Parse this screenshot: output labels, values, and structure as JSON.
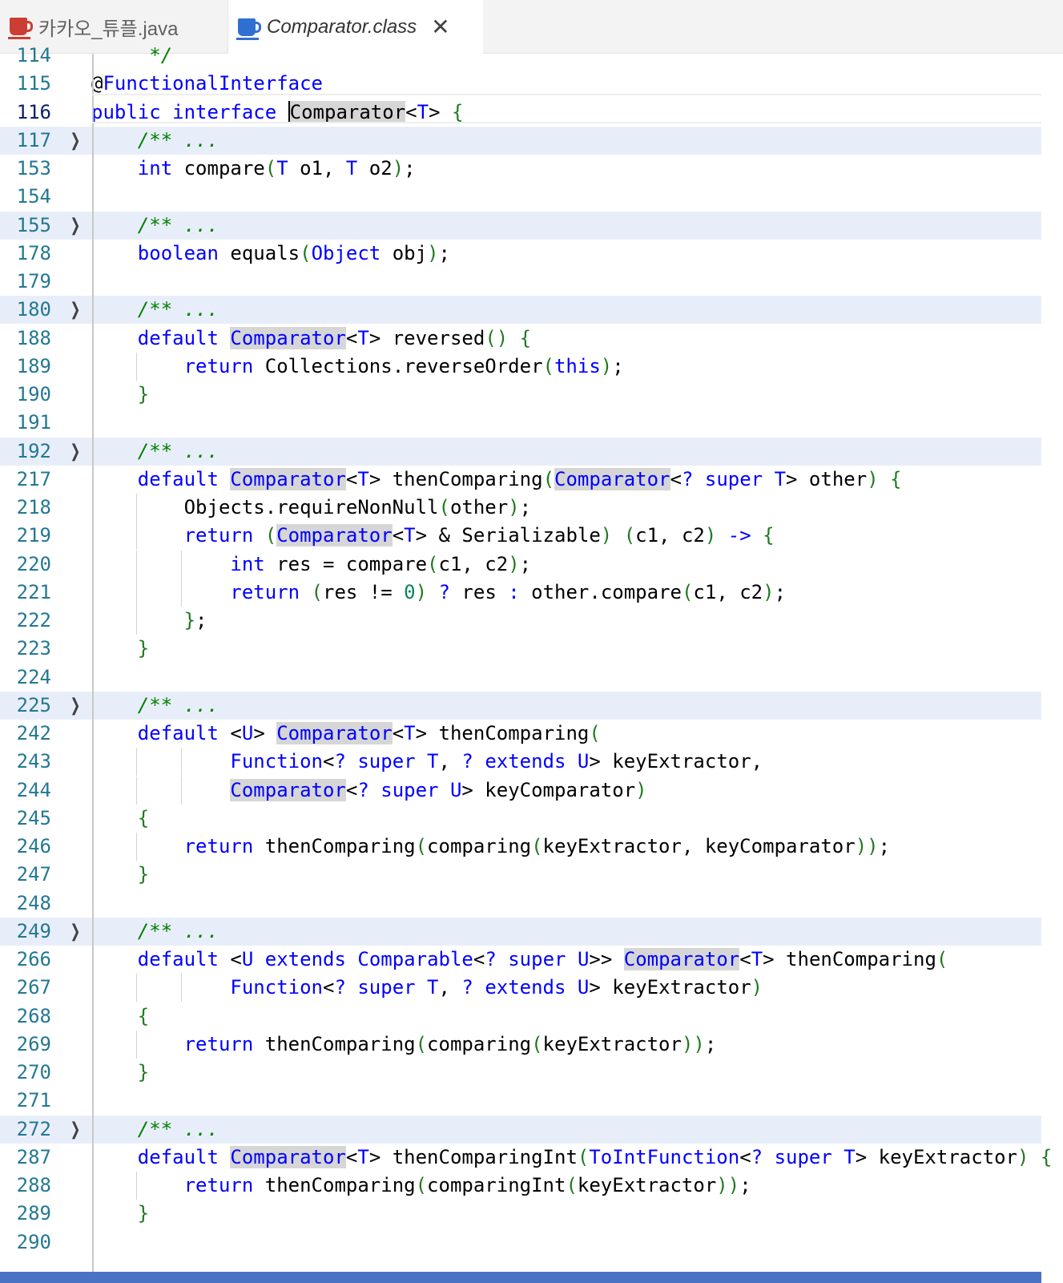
{
  "tabs": [
    {
      "label": "카카오_튜플.java",
      "active": false
    },
    {
      "label": "Comparator.class",
      "active": true,
      "close": "✕"
    }
  ],
  "editor": {
    "lines": [
      {
        "n": "114",
        "segs": [
          [
            "",
            "    "
          ],
          [
            "c",
            " */"
          ]
        ],
        "top_partial": true
      },
      {
        "n": "115",
        "segs": [
          [
            "",
            "@"
          ],
          [
            "k",
            "FunctionalInterface"
          ]
        ]
      },
      {
        "n": "116",
        "segs": [
          [
            "k",
            "public"
          ],
          [
            "",
            " "
          ],
          [
            "k",
            "interface"
          ],
          [
            "",
            " "
          ],
          [
            "cur",
            ""
          ],
          [
            "hi",
            "Comparator"
          ],
          [
            "",
            "<"
          ],
          [
            "k",
            "T"
          ],
          [
            "",
            "> "
          ],
          [
            "b",
            "{"
          ]
        ],
        "current": true
      },
      {
        "n": "117",
        "fold": true,
        "segs": [
          [
            "",
            "    "
          ],
          [
            "c",
            "/** ..."
          ]
        ]
      },
      {
        "n": "153",
        "segs": [
          [
            "",
            "    "
          ],
          [
            "k",
            "int"
          ],
          [
            "",
            " compare"
          ],
          [
            "b",
            "("
          ],
          [
            "k",
            "T"
          ],
          [
            "",
            " o1, "
          ],
          [
            "k",
            "T"
          ],
          [
            "",
            " o2"
          ],
          [
            "b",
            ")"
          ],
          [
            "",
            ";"
          ]
        ]
      },
      {
        "n": "154",
        "segs": []
      },
      {
        "n": "155",
        "fold": true,
        "segs": [
          [
            "",
            "    "
          ],
          [
            "c",
            "/** ..."
          ]
        ]
      },
      {
        "n": "178",
        "segs": [
          [
            "",
            "    "
          ],
          [
            "k",
            "boolean"
          ],
          [
            "",
            " equals"
          ],
          [
            "b",
            "("
          ],
          [
            "k",
            "Object"
          ],
          [
            "",
            " obj"
          ],
          [
            "b",
            ")"
          ],
          [
            "",
            ";"
          ]
        ]
      },
      {
        "n": "179",
        "segs": []
      },
      {
        "n": "180",
        "fold": true,
        "segs": [
          [
            "",
            "    "
          ],
          [
            "c",
            "/** ..."
          ]
        ]
      },
      {
        "n": "188",
        "segs": [
          [
            "",
            "    "
          ],
          [
            "k",
            "default"
          ],
          [
            "",
            " "
          ],
          [
            "hik",
            "Comparator"
          ],
          [
            "",
            "<"
          ],
          [
            "k",
            "T"
          ],
          [
            "",
            "> reversed"
          ],
          [
            "b",
            "()"
          ],
          [
            "",
            " "
          ],
          [
            "b",
            "{"
          ]
        ]
      },
      {
        "n": "189",
        "guides": [
          1
        ],
        "segs": [
          [
            "",
            "        "
          ],
          [
            "k",
            "return"
          ],
          [
            "",
            " Collections.reverseOrder"
          ],
          [
            "b",
            "("
          ],
          [
            "k",
            "this"
          ],
          [
            "b",
            ")"
          ],
          [
            "",
            ";"
          ]
        ]
      },
      {
        "n": "190",
        "segs": [
          [
            "",
            "    "
          ],
          [
            "b",
            "}"
          ]
        ]
      },
      {
        "n": "191",
        "segs": []
      },
      {
        "n": "192",
        "fold": true,
        "segs": [
          [
            "",
            "    "
          ],
          [
            "c",
            "/** ..."
          ]
        ]
      },
      {
        "n": "217",
        "segs": [
          [
            "",
            "    "
          ],
          [
            "k",
            "default"
          ],
          [
            "",
            " "
          ],
          [
            "hik",
            "Comparator"
          ],
          [
            "",
            "<"
          ],
          [
            "k",
            "T"
          ],
          [
            "",
            "> thenComparing"
          ],
          [
            "b",
            "("
          ],
          [
            "hik",
            "Comparator"
          ],
          [
            "",
            "<"
          ],
          [
            "k",
            "?"
          ],
          [
            "",
            " "
          ],
          [
            "k",
            "super"
          ],
          [
            "",
            " "
          ],
          [
            "k",
            "T"
          ],
          [
            "",
            "> other"
          ],
          [
            "b",
            ")"
          ],
          [
            "",
            " "
          ],
          [
            "b",
            "{"
          ]
        ]
      },
      {
        "n": "218",
        "guides": [
          1
        ],
        "segs": [
          [
            "",
            "        Objects.requireNonNull"
          ],
          [
            "b",
            "("
          ],
          [
            "",
            "other"
          ],
          [
            "b",
            ")"
          ],
          [
            "",
            ";"
          ]
        ]
      },
      {
        "n": "219",
        "guides": [
          1
        ],
        "segs": [
          [
            "",
            "        "
          ],
          [
            "k",
            "return"
          ],
          [
            "",
            " "
          ],
          [
            "b",
            "("
          ],
          [
            "hik",
            "Comparator"
          ],
          [
            "",
            "<"
          ],
          [
            "k",
            "T"
          ],
          [
            "",
            "> & Serializable"
          ],
          [
            "b",
            ")"
          ],
          [
            "",
            " "
          ],
          [
            "b",
            "("
          ],
          [
            "",
            "c1, c2"
          ],
          [
            "b",
            ")"
          ],
          [
            "",
            " "
          ],
          [
            "k",
            "->"
          ],
          [
            "",
            " "
          ],
          [
            "b",
            "{"
          ]
        ]
      },
      {
        "n": "220",
        "guides": [
          1,
          2
        ],
        "segs": [
          [
            "",
            "            "
          ],
          [
            "k",
            "int"
          ],
          [
            "",
            " res = compare"
          ],
          [
            "b",
            "("
          ],
          [
            "",
            "c1, c2"
          ],
          [
            "b",
            ")"
          ],
          [
            "",
            ";"
          ]
        ]
      },
      {
        "n": "221",
        "guides": [
          1,
          2
        ],
        "segs": [
          [
            "",
            "            "
          ],
          [
            "k",
            "return"
          ],
          [
            "",
            " "
          ],
          [
            "b",
            "("
          ],
          [
            "",
            "res != "
          ],
          [
            "n",
            "0"
          ],
          [
            "b",
            ")"
          ],
          [
            "",
            " "
          ],
          [
            "k",
            "?"
          ],
          [
            "",
            " res "
          ],
          [
            "k",
            ":"
          ],
          [
            "",
            " other.compare"
          ],
          [
            "b",
            "("
          ],
          [
            "",
            "c1, c2"
          ],
          [
            "b",
            ")"
          ],
          [
            "",
            ";"
          ]
        ]
      },
      {
        "n": "222",
        "guides": [
          1
        ],
        "segs": [
          [
            "",
            "        "
          ],
          [
            "b",
            "}"
          ],
          [
            "",
            ";"
          ]
        ]
      },
      {
        "n": "223",
        "segs": [
          [
            "",
            "    "
          ],
          [
            "b",
            "}"
          ]
        ]
      },
      {
        "n": "224",
        "segs": []
      },
      {
        "n": "225",
        "fold": true,
        "segs": [
          [
            "",
            "    "
          ],
          [
            "c",
            "/** ..."
          ]
        ]
      },
      {
        "n": "242",
        "segs": [
          [
            "",
            "    "
          ],
          [
            "k",
            "default"
          ],
          [
            "",
            " <"
          ],
          [
            "k",
            "U"
          ],
          [
            "",
            "> "
          ],
          [
            "hik",
            "Comparator"
          ],
          [
            "",
            "<"
          ],
          [
            "k",
            "T"
          ],
          [
            "",
            "> thenComparing"
          ],
          [
            "b",
            "("
          ]
        ]
      },
      {
        "n": "243",
        "guides": [
          1,
          2
        ],
        "segs": [
          [
            "",
            "            "
          ],
          [
            "k",
            "Function"
          ],
          [
            "",
            "<"
          ],
          [
            "k",
            "?"
          ],
          [
            "",
            " "
          ],
          [
            "k",
            "super"
          ],
          [
            "",
            " "
          ],
          [
            "k",
            "T"
          ],
          [
            ", ",
            ""
          ],
          [
            "",
            ", "
          ],
          [
            "k",
            "?"
          ],
          [
            "",
            " "
          ],
          [
            "k",
            "extends"
          ],
          [
            "",
            " "
          ],
          [
            "k",
            "U"
          ],
          [
            "",
            "> keyExtractor,"
          ]
        ]
      },
      {
        "n": "244",
        "guides": [
          1,
          2
        ],
        "segs": [
          [
            "",
            "            "
          ],
          [
            "hik",
            "Comparator"
          ],
          [
            "",
            "<"
          ],
          [
            "k",
            "?"
          ],
          [
            "",
            " "
          ],
          [
            "k",
            "super"
          ],
          [
            "",
            " "
          ],
          [
            "k",
            "U"
          ],
          [
            "",
            "> keyComparator"
          ],
          [
            "b",
            ")"
          ]
        ]
      },
      {
        "n": "245",
        "segs": [
          [
            "",
            "    "
          ],
          [
            "b",
            "{"
          ]
        ]
      },
      {
        "n": "246",
        "guides": [
          1
        ],
        "segs": [
          [
            "",
            "        "
          ],
          [
            "k",
            "return"
          ],
          [
            "",
            " thenComparing"
          ],
          [
            "b",
            "("
          ],
          [
            "",
            "comparing"
          ],
          [
            "b",
            "("
          ],
          [
            "",
            "keyExtractor, keyComparator"
          ],
          [
            "b",
            "))"
          ],
          [
            "",
            ";"
          ]
        ]
      },
      {
        "n": "247",
        "segs": [
          [
            "",
            "    "
          ],
          [
            "b",
            "}"
          ]
        ]
      },
      {
        "n": "248",
        "segs": []
      },
      {
        "n": "249",
        "fold": true,
        "segs": [
          [
            "",
            "    "
          ],
          [
            "c",
            "/** ..."
          ]
        ]
      },
      {
        "n": "266",
        "segs": [
          [
            "",
            "    "
          ],
          [
            "k",
            "default"
          ],
          [
            "",
            " <"
          ],
          [
            "k",
            "U"
          ],
          [
            "",
            " "
          ],
          [
            "k",
            "extends"
          ],
          [
            "",
            " "
          ],
          [
            "k",
            "Comparable"
          ],
          [
            "",
            "<"
          ],
          [
            "k",
            "?"
          ],
          [
            "",
            " "
          ],
          [
            "k",
            "super"
          ],
          [
            "",
            " "
          ],
          [
            "k",
            "U"
          ],
          [
            "",
            ">> "
          ],
          [
            "hik",
            "Comparator"
          ],
          [
            "",
            "<"
          ],
          [
            "k",
            "T"
          ],
          [
            "",
            "> thenComparing"
          ],
          [
            "b",
            "("
          ]
        ]
      },
      {
        "n": "267",
        "guides": [
          1,
          2
        ],
        "segs": [
          [
            "",
            "            "
          ],
          [
            "k",
            "Function"
          ],
          [
            "",
            "<"
          ],
          [
            "k",
            "?"
          ],
          [
            "",
            " "
          ],
          [
            "k",
            "super"
          ],
          [
            "",
            " "
          ],
          [
            "k",
            "T"
          ],
          [
            "",
            ", "
          ],
          [
            "k",
            "?"
          ],
          [
            "",
            " "
          ],
          [
            "k",
            "extends"
          ],
          [
            "",
            " "
          ],
          [
            "k",
            "U"
          ],
          [
            "",
            "> keyExtractor"
          ],
          [
            "b",
            ")"
          ]
        ]
      },
      {
        "n": "268",
        "segs": [
          [
            "",
            "    "
          ],
          [
            "b",
            "{"
          ]
        ]
      },
      {
        "n": "269",
        "guides": [
          1
        ],
        "segs": [
          [
            "",
            "        "
          ],
          [
            "k",
            "return"
          ],
          [
            "",
            " thenComparing"
          ],
          [
            "b",
            "("
          ],
          [
            "",
            "comparing"
          ],
          [
            "b",
            "("
          ],
          [
            "",
            "keyExtractor"
          ],
          [
            "b",
            "))"
          ],
          [
            "",
            ";"
          ]
        ]
      },
      {
        "n": "270",
        "segs": [
          [
            "",
            "    "
          ],
          [
            "b",
            "}"
          ]
        ]
      },
      {
        "n": "271",
        "segs": []
      },
      {
        "n": "272",
        "fold": true,
        "segs": [
          [
            "",
            "    "
          ],
          [
            "c",
            "/** ..."
          ]
        ]
      },
      {
        "n": "287",
        "segs": [
          [
            "",
            "    "
          ],
          [
            "k",
            "default"
          ],
          [
            "",
            " "
          ],
          [
            "hik",
            "Comparator"
          ],
          [
            "",
            "<"
          ],
          [
            "k",
            "T"
          ],
          [
            "",
            "> thenComparingInt"
          ],
          [
            "b",
            "("
          ],
          [
            "k",
            "ToIntFunction"
          ],
          [
            "",
            "<"
          ],
          [
            "k",
            "?"
          ],
          [
            "",
            " "
          ],
          [
            "k",
            "super"
          ],
          [
            "",
            " "
          ],
          [
            "k",
            "T"
          ],
          [
            "",
            "> keyExtractor"
          ],
          [
            "b",
            ")"
          ],
          [
            "",
            " "
          ],
          [
            "b",
            "{"
          ]
        ]
      },
      {
        "n": "288",
        "guides": [
          1
        ],
        "segs": [
          [
            "",
            "        "
          ],
          [
            "k",
            "return"
          ],
          [
            "",
            " thenComparing"
          ],
          [
            "b",
            "("
          ],
          [
            "",
            "comparingInt"
          ],
          [
            "b",
            "("
          ],
          [
            "",
            "keyExtractor"
          ],
          [
            "b",
            "))"
          ],
          [
            "",
            ";"
          ]
        ]
      },
      {
        "n": "289",
        "segs": [
          [
            "",
            "    "
          ],
          [
            "b",
            "}"
          ]
        ]
      },
      {
        "n": "290",
        "segs": []
      }
    ]
  },
  "colors": {
    "keyword": "#0000ff",
    "bracket": "#1f7a1f",
    "comment": "#008000",
    "line_number": "#237893",
    "fold_highlight": "#e8eef9",
    "status_bar": "#4a72c4"
  },
  "icons": {
    "java_file": "java-file-icon",
    "class_file": "class-file-icon",
    "close": "close-icon",
    "fold": "chevron-right-icon"
  }
}
